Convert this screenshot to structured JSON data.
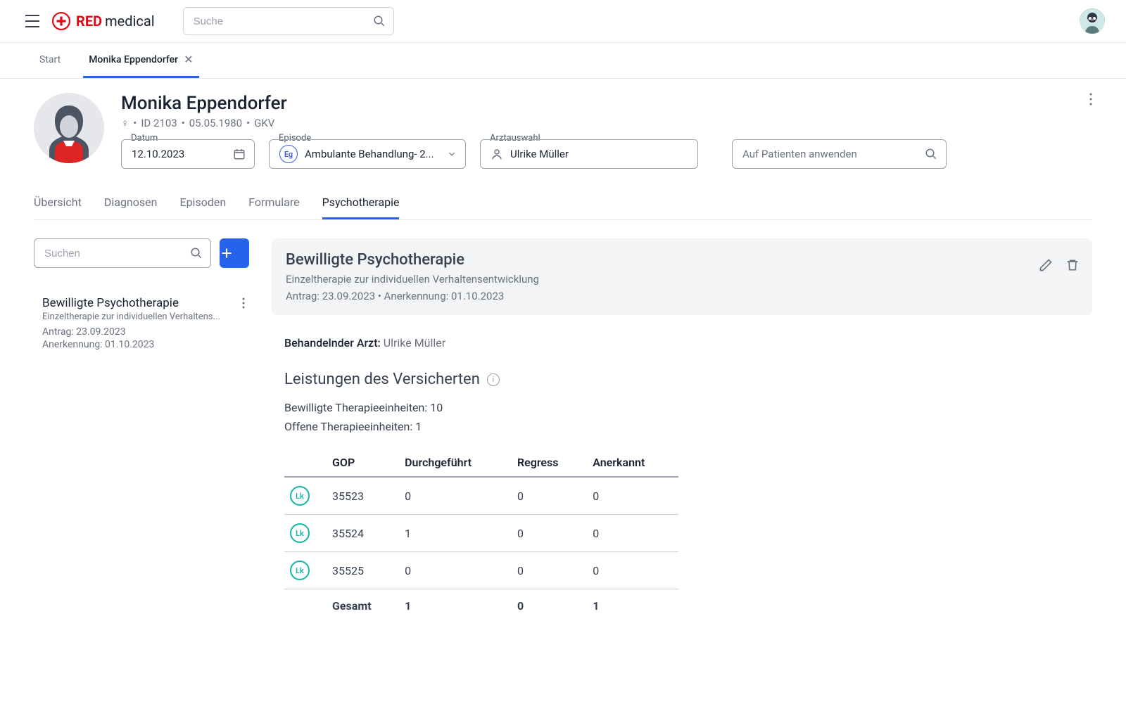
{
  "header": {
    "logo_red": "RED",
    "logo_med": "medical",
    "search_placeholder": "Suche"
  },
  "page_tabs": {
    "start": "Start",
    "patient": "Monika Eppendorfer"
  },
  "patient": {
    "name": "Monika Eppendorfer",
    "gender_symbol": "♀",
    "id_label": "ID 2103",
    "dob": "05.05.1980",
    "insurance": "GKV"
  },
  "fields": {
    "datum_label": "Datum",
    "datum_value": "12.10.2023",
    "episode_label": "Episode",
    "episode_badge": "Eg",
    "episode_value": "Ambulante Behandlung- 2...",
    "arzt_label": "Arztauswahl",
    "arzt_value": "Ulrike Müller",
    "patient_placeholder": "Auf Patienten anwenden"
  },
  "sub_tabs": {
    "uebersicht": "Übersicht",
    "diagnosen": "Diagnosen",
    "episoden": "Episoden",
    "formulare": "Formulare",
    "psychotherapie": "Psychotherapie"
  },
  "side": {
    "search_placeholder": "Suchen",
    "item": {
      "title": "Bewilligte Psychotherapie",
      "subtitle": "Einzeltherapie zur individuellen Verhaltens...",
      "antrag": "Antrag: 23.09.2023",
      "anerk": "Anerkennung: 01.10.2023"
    }
  },
  "detail": {
    "title": "Bewilligte Psychotherapie",
    "subtitle": "Einzeltherapie zur individuellen Verhaltensentwicklung",
    "meta": "Antrag: 23.09.2023  •  Anerkennung: 01.10.2023",
    "doctor_label": "Behandelnder Arzt:",
    "doctor_value": "Ulrike Müller",
    "section_title": "Leistungen des Versicherten",
    "bewilligt": "Bewilligte Therapieeinheiten: 10",
    "offen": "Offene Therapieeinheiten: 1"
  },
  "table": {
    "headers": {
      "gop": "GOP",
      "durch": "Durchgeführt",
      "regress": "Regress",
      "anerkannt": "Anerkannt"
    },
    "lk": "Lk",
    "rows": [
      {
        "gop": "35523",
        "durch": "0",
        "regress": "0",
        "anerkannt": "0"
      },
      {
        "gop": "35524",
        "durch": "1",
        "regress": "0",
        "anerkannt": "0"
      },
      {
        "gop": "35525",
        "durch": "0",
        "regress": "0",
        "anerkannt": "0"
      }
    ],
    "footer": {
      "label": "Gesamt",
      "durch": "1",
      "regress": "0",
      "anerkannt": "1"
    }
  }
}
